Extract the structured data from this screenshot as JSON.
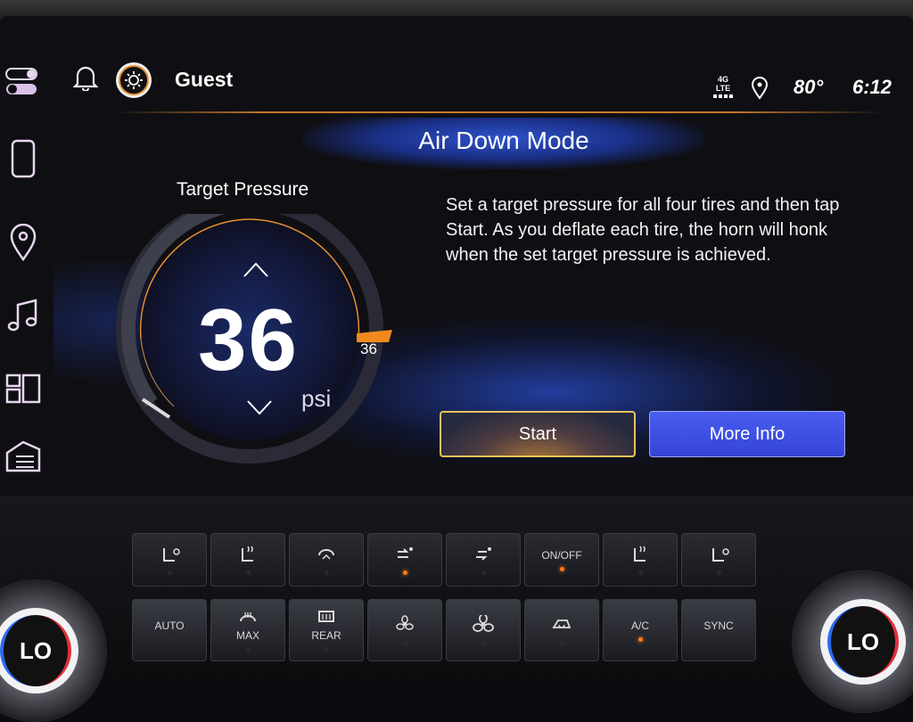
{
  "status_bar": {
    "user_name": "Guest",
    "network": "4G LTE",
    "network_line1": "4G",
    "network_line2": "LTE",
    "temperature": "80°",
    "time": "6:12"
  },
  "sidebar": {
    "items": [
      {
        "icon": "toggles-icon"
      },
      {
        "icon": "phone-icon"
      },
      {
        "icon": "location-pin-icon"
      },
      {
        "icon": "music-note-icon"
      },
      {
        "icon": "apps-grid-icon"
      },
      {
        "icon": "vehicle-settings-icon"
      }
    ]
  },
  "screen": {
    "title": "Air Down Mode",
    "target_label": "Target Pressure",
    "target_value": "36",
    "marker_value": "36",
    "unit": "psi",
    "description": "Set a target pressure for all four tires and then tap Start. As you deflate each tire, the horn will honk when the set target pressure is achieved.",
    "start_label": "Start",
    "more_info_label": "More Info"
  },
  "colors": {
    "accent_orange": "#e89030",
    "primary_blue": "#3b4fe0",
    "start_border": "#e8c25a"
  },
  "climate": {
    "row1": [
      {
        "icon": "heated-cooled-seat-icon",
        "label": "",
        "led": false
      },
      {
        "icon": "heated-seat-icon",
        "label": "",
        "led": false
      },
      {
        "icon": "defrost-vent-icon",
        "label": "",
        "led": false
      },
      {
        "icon": "airflow-upper-icon",
        "label": "",
        "led": true
      },
      {
        "icon": "airflow-lower-icon",
        "label": "",
        "led": false
      },
      {
        "icon": "",
        "label": "ON/OFF",
        "led": true
      },
      {
        "icon": "heated-seat-icon",
        "label": "",
        "led": false
      },
      {
        "icon": "heated-cooled-seat-icon",
        "label": "",
        "led": false
      }
    ],
    "row2": [
      {
        "icon": "",
        "label": "AUTO",
        "led": false
      },
      {
        "icon": "max-defrost-icon",
        "label": "MAX",
        "led": false
      },
      {
        "icon": "rear-defrost-icon",
        "label": "REAR",
        "led": false
      },
      {
        "icon": "fan-low-icon",
        "label": "",
        "led": false
      },
      {
        "icon": "fan-high-icon",
        "label": "",
        "led": false
      },
      {
        "icon": "recirculation-icon",
        "label": "",
        "led": false
      },
      {
        "icon": "",
        "label": "A/C",
        "led": true
      },
      {
        "icon": "",
        "label": "SYNC",
        "led": false
      }
    ],
    "left_knob": "LO",
    "right_knob": "LO"
  }
}
